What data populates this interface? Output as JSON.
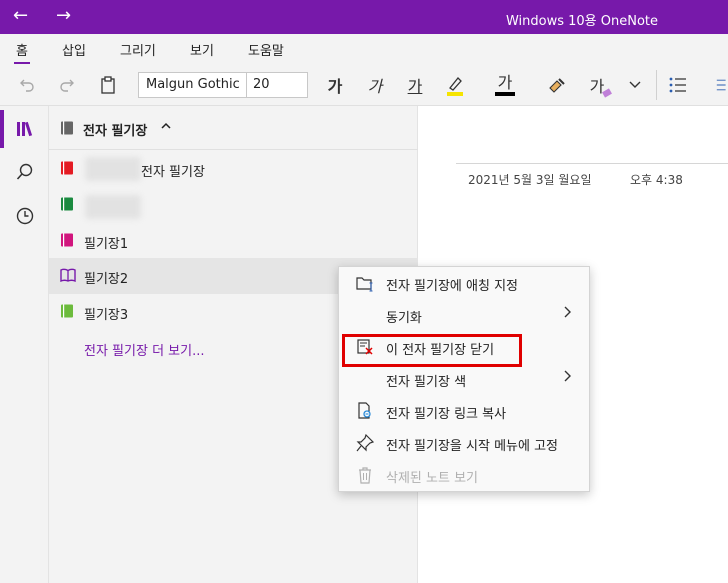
{
  "titlebar": {
    "title": "Windows 10용 OneNote",
    "back_icon": "←",
    "forward_icon": "→",
    "bg_color": "#7719aa"
  },
  "menu_tabs": [
    {
      "label": "홈",
      "active": true
    },
    {
      "label": "삽입"
    },
    {
      "label": "그리기"
    },
    {
      "label": "보기"
    },
    {
      "label": "도움말"
    }
  ],
  "ribbon": {
    "font_name": "Malgun Gothic",
    "font_size": "20",
    "bold_glyph": "가",
    "italic_glyph": "가",
    "underline_glyph": "가",
    "font_color_glyph": "가",
    "format_glyph": "가",
    "highlight_color": "#f5e400",
    "font_color": "#000000"
  },
  "notebook_panel": {
    "header_label": "전자 필기장",
    "caret": "^",
    "items": [
      {
        "name": "전자 필기장",
        "color": "#e41b23",
        "blurred_prefix": true
      },
      {
        "name": "",
        "color": "#1a8a3f",
        "blurred_prefix": true
      },
      {
        "name": "필기장1",
        "color": "#d1157d"
      },
      {
        "name": "필기장2",
        "color": "#7719aa",
        "open": true
      },
      {
        "name": "필기장3",
        "color": "#6cbb3c"
      }
    ],
    "more_link": "전자 필기장 더 보기..."
  },
  "page": {
    "date": "2021년 5월 3일 월요일",
    "time": "오후 4:38"
  },
  "context_menu": {
    "items": [
      {
        "label": "전자 필기장에 애칭 지정",
        "icon": "folder-rename-icon"
      },
      {
        "label": "동기화",
        "submenu": true
      },
      {
        "label": "이 전자 필기장 닫기",
        "icon": "close-notebook-icon",
        "highlighted": true
      },
      {
        "label": "전자 필기장 색",
        "submenu": true
      },
      {
        "label": "전자 필기장 링크 복사",
        "icon": "copy-link-icon"
      },
      {
        "label": "전자 필기장을 시작 메뉴에 고정",
        "icon": "pin-icon"
      },
      {
        "label": "삭제된 노트 보기",
        "icon": "trash-icon",
        "disabled": true
      }
    ],
    "chevron": ">"
  }
}
